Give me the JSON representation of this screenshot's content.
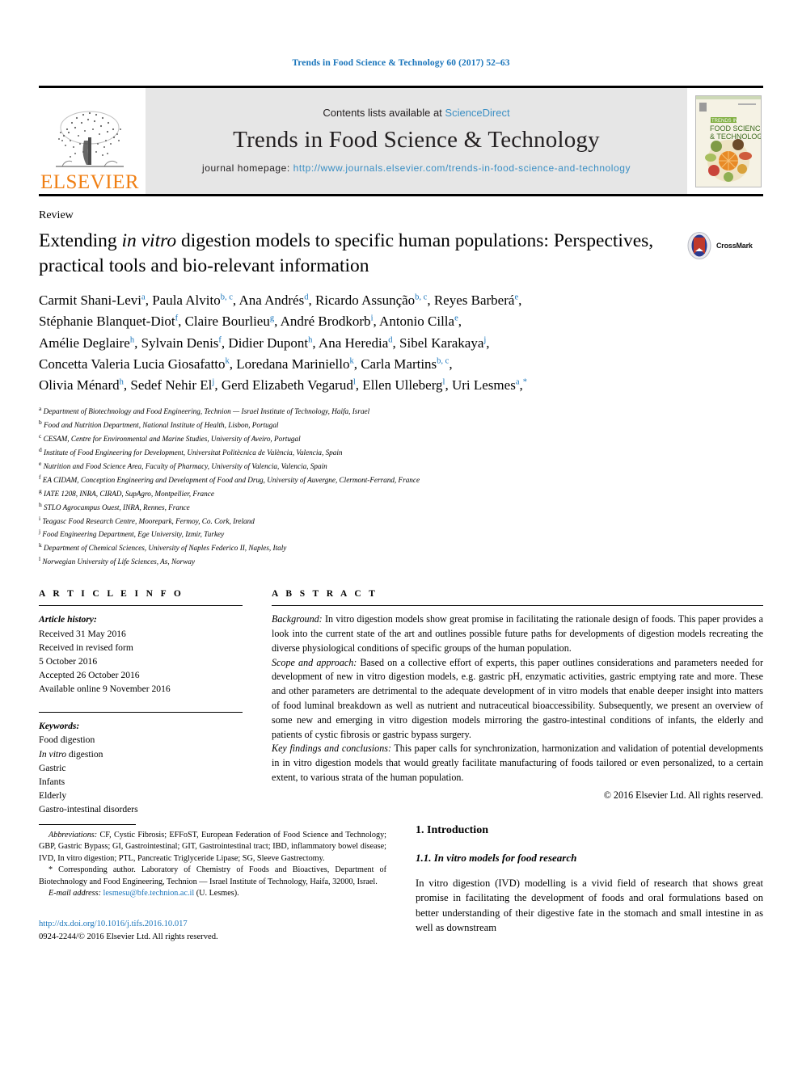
{
  "running_head": "Trends in Food Science & Technology 60 (2017) 52–63",
  "masthead": {
    "publisher_name": "ELSEVIER",
    "contents_prefix": "Contents lists available at ",
    "contents_link": "ScienceDirect",
    "journal_title": "Trends in Food Science & Technology",
    "homepage_label": "journal homepage: ",
    "homepage_url": "http://www.journals.elsevier.com/trends-in-food-science-and-technology",
    "cover_title_line1": "TRENDS IN",
    "cover_title_line2": "FOOD SCIENCE",
    "cover_title_line3": "& TECHNOLOGY"
  },
  "article": {
    "doc_type": "Review",
    "title_part1": "Extending ",
    "title_italic": "in vitro",
    "title_part2": " digestion models to specific human populations: Perspectives, practical tools and bio-relevant information",
    "crossmark_label": "CrossMark",
    "authors_line1": "Carmit Shani-Levi a, Paula Alvito b, c, Ana Andrés d, Ricardo Assunção b, c, Reyes Barberá e,",
    "authors_line2": "Stéphanie Blanquet-Diot f, Claire Bourlieu g, André Brodkorb i, Antonio Cilla e,",
    "authors_line3": "Amélie Deglaire h, Sylvain Denis f, Didier Dupont h, Ana Heredia d, Sibel Karakaya j,",
    "authors_line4": "Concetta Valeria Lucia Giosafatto k, Loredana Mariniello k, Carla Martins b, c,",
    "authors_line5": "Olivia Ménard h, Sedef Nehir El j, Gerd Elizabeth Vegarud l, Ellen Ulleberg l, Uri Lesmes a, *",
    "affiliations": [
      {
        "marker": "a",
        "text": "Department of Biotechnology and Food Engineering, Technion — Israel Institute of Technology, Haifa, Israel"
      },
      {
        "marker": "b",
        "text": "Food and Nutrition Department, National Institute of Health, Lisbon, Portugal"
      },
      {
        "marker": "c",
        "text": "CESAM, Centre for Environmental and Marine Studies, University of Aveiro, Portugal"
      },
      {
        "marker": "d",
        "text": "Institute of Food Engineering for Development, Universitat Politècnica de València, Valencia, Spain"
      },
      {
        "marker": "e",
        "text": "Nutrition and Food Science Area, Faculty of Pharmacy, University of Valencia, Valencia, Spain"
      },
      {
        "marker": "f",
        "text": "EA CIDAM, Conception Engineering and Development of Food and Drug, University of Auvergne, Clermont-Ferrand, France"
      },
      {
        "marker": "g",
        "text": "IATE 1208, INRA, CIRAD, SupAgro, Montpellier, France"
      },
      {
        "marker": "h",
        "text": "STLO Agrocampus Ouest, INRA, Rennes, France"
      },
      {
        "marker": "i",
        "text": "Teagasc Food Research Centre, Moorepark, Fermoy, Co. Cork, Ireland"
      },
      {
        "marker": "j",
        "text": "Food Engineering Department, Ege University, Izmir, Turkey"
      },
      {
        "marker": "k",
        "text": "Department of Chemical Sciences, University of Naples Federico II, Naples, Italy"
      },
      {
        "marker": "l",
        "text": "Norwegian University of Life Sciences, As, Norway"
      }
    ]
  },
  "article_info": {
    "heading": "A R T I C L E   I N F O",
    "history_label": "Article history:",
    "history": [
      "Received 31 May 2016",
      "Received in revised form",
      "5 October 2016",
      "Accepted 26 October 2016",
      "Available online 9 November 2016"
    ],
    "keywords_label": "Keywords:",
    "keywords": [
      "Food digestion",
      "In vitro digestion",
      "Gastric",
      "Infants",
      "Elderly",
      "Gastro-intestinal disorders"
    ]
  },
  "abstract": {
    "heading": "A B S T R A C T",
    "background_label": "Background:",
    "background_text": " In vitro digestion models show great promise in facilitating the rationale design of foods. This paper provides a look into the current state of the art and outlines possible future paths for developments of digestion models recreating the diverse physiological conditions of specific groups of the human population.",
    "scope_label": "Scope and approach:",
    "scope_text": " Based on a collective effort of experts, this paper outlines considerations and parameters needed for development of new in vitro digestion models, e.g. gastric pH, enzymatic activities, gastric emptying rate and more. These and other parameters are detrimental to the adequate development of in vitro models that enable deeper insight into matters of food luminal breakdown as well as nutrient and nutraceutical bioaccessibility. Subsequently, we present an overview of some new and emerging in vitro digestion models mirroring the gastro-intestinal conditions of infants, the elderly and patients of cystic fibrosis or gastric bypass surgery.",
    "key_label": "Key findings and conclusions:",
    "key_text": " This paper calls for synchronization, harmonization and validation of potential developments in in vitro digestion models that would greatly facilitate manufacturing of foods tailored or even personalized, to a certain extent, to various strata of the human population.",
    "copyright": "© 2016 Elsevier Ltd. All rights reserved."
  },
  "footnotes": {
    "abbreviations_label": "Abbreviations:",
    "abbreviations_text": " CF, Cystic Fibrosis; EFFoST, European Federation of Food Science and Technology; GBP, Gastric Bypass; GI, Gastrointestinal; GIT, Gastrointestinal tract; IBD, inflammatory bowel disease; IVD, In vitro digestion; PTL, Pancreatic Triglyceride Lipase; SG, Sleeve Gastrectomy.",
    "corresponding_text": "* Corresponding author. Laboratory of Chemistry of Foods and Bioactives, Department of Biotechnology and Food Engineering, Technion — Israel Institute of Technology, Haifa, 32000, Israel.",
    "email_label": "E-mail address:",
    "email_address": "lesmesu@bfe.technion.ac.il",
    "email_suffix": " (U. Lesmes).",
    "doi_url": "http://dx.doi.org/10.1016/j.tifs.2016.10.017",
    "issn_line": "0924-2244/© 2016 Elsevier Ltd. All rights reserved."
  },
  "introduction": {
    "h1": "1. Introduction",
    "h2_number": "1.1. ",
    "h2_italic": "In vitro",
    "h2_rest": " models for food research",
    "paragraph": "In vitro digestion (IVD) modelling is a vivid field of research that shows great promise in facilitating the development of foods and oral formulations based on better understanding of their digestive fate in the stomach and small intestine in as well as downstream"
  },
  "colors": {
    "link_blue": "#1a75bb",
    "elsevier_orange": "#f07f13",
    "banner_grey": "#e6e6e6",
    "sciencedirect_blue": "#3b8fc4"
  }
}
